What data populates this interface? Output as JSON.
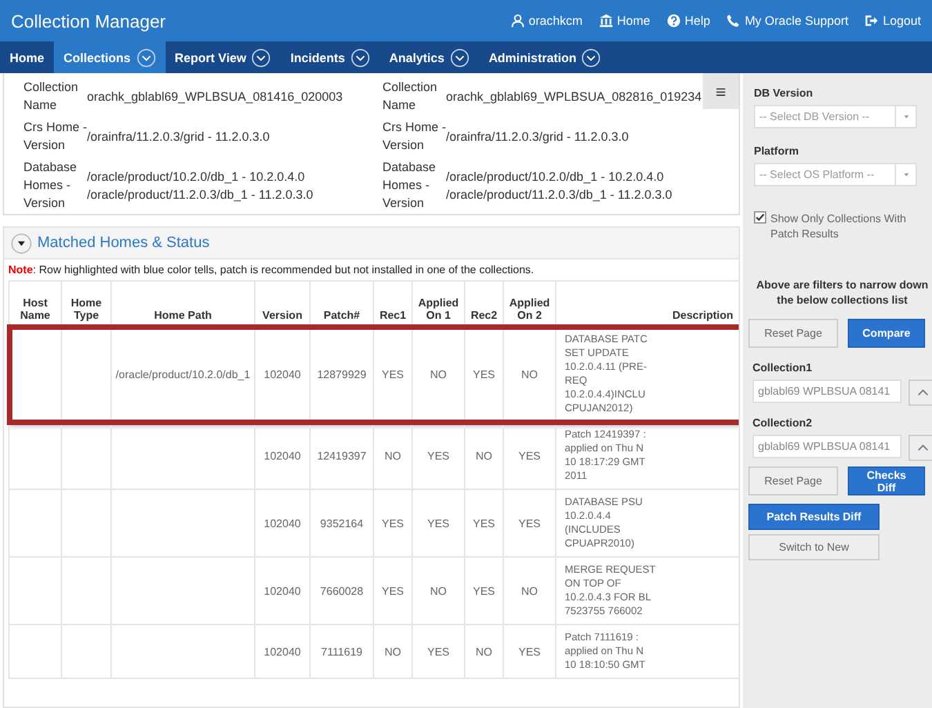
{
  "header": {
    "title": "Collection Manager",
    "links": [
      {
        "kind": "user",
        "label": "orachkcm"
      },
      {
        "kind": "home",
        "label": "Home"
      },
      {
        "kind": "help",
        "label": "Help"
      },
      {
        "kind": "phone",
        "label": "My Oracle Support"
      },
      {
        "kind": "logout",
        "label": "Logout"
      }
    ]
  },
  "nav": {
    "tabs": [
      {
        "label": "Home",
        "selected": false,
        "has_menu": false
      },
      {
        "label": "Collections",
        "selected": true,
        "has_menu": true
      },
      {
        "label": "Report View",
        "selected": false,
        "has_menu": true
      },
      {
        "label": "Incidents",
        "selected": false,
        "has_menu": true
      },
      {
        "label": "Analytics",
        "selected": false,
        "has_menu": true
      },
      {
        "label": "Administration",
        "selected": false,
        "has_menu": true
      }
    ]
  },
  "info": {
    "columns": [
      {
        "rows": [
          {
            "label": "Collection Name",
            "values": [
              "orachk_gblabl69_WPLBSUA_081416_020003"
            ]
          },
          {
            "label": "Crs Home - Version",
            "values": [
              "/orainfra/11.2.0.3/grid - 11.2.0.3.0"
            ]
          },
          {
            "label": "Database Homes - Version",
            "values": [
              "/oracle/product/10.2.0/db_1 - 10.2.0.4.0",
              "/oracle/product/11.2.0.3/db_1 - 11.2.0.3.0"
            ]
          }
        ]
      },
      {
        "rows": [
          {
            "label": "Collection Name",
            "values": [
              "orachk_gblabl69_WPLBSUA_082816_019234"
            ]
          },
          {
            "label": "Crs Home - Version",
            "values": [
              "/orainfra/11.2.0.3/grid - 11.2.0.3.0"
            ]
          },
          {
            "label": "Database Homes - Version",
            "values": [
              "/oracle/product/10.2.0/db_1 - 10.2.0.4.0",
              "/oracle/product/11.2.0.3/db_1 - 11.2.0.3.0"
            ]
          }
        ]
      }
    ],
    "menu_button": "≡"
  },
  "matched": {
    "title": "Matched Homes & Status",
    "expanded": true,
    "note_label": "Note",
    "note_text": ": Row highlighted with blue color tells, patch is recommended but not installed in one of the collections.",
    "columns": [
      "Host Name",
      "Home Type",
      "Home Path",
      "Version",
      "Patch#",
      "Rec1",
      "Applied On 1",
      "Rec2",
      "Applied On 2",
      "Description"
    ],
    "rows": [
      {
        "highlighted": true,
        "home_path": "/oracle/product/10.2.0/db_1",
        "version": "102040",
        "patch": "12879929",
        "rec1": "YES",
        "applied1": "NO",
        "rec2": "YES",
        "applied2": "NO",
        "description_lines": [
          "DATABASE PATC",
          "SET UPDATE",
          "10.2.0.4.11 (PRE-",
          "REQ",
          "10.2.0.4.4)INCLU",
          "CPUJAN2012)"
        ]
      },
      {
        "highlighted": false,
        "version": "102040",
        "patch": "12419397",
        "rec1": "NO",
        "applied1": "YES",
        "rec2": "NO",
        "applied2": "YES",
        "description_lines": [
          "Patch 12419397 :",
          "applied on Thu N",
          "10 18:17:29 GMT",
          "2011"
        ]
      },
      {
        "highlighted": false,
        "version": "102040",
        "patch": "9352164",
        "rec1": "YES",
        "applied1": "YES",
        "rec2": "YES",
        "applied2": "YES",
        "description_lines": [
          "DATABASE PSU",
          "10.2.0.4.4",
          "(INCLUDES",
          "CPUAPR2010)"
        ]
      },
      {
        "highlighted": false,
        "version": "102040",
        "patch": "7660028",
        "rec1": "YES",
        "applied1": "NO",
        "rec2": "YES",
        "applied2": "NO",
        "description_lines": [
          "MERGE REQUEST",
          "ON TOP OF",
          "10.2.0.4.3 FOR BL",
          "7523755 766002"
        ]
      },
      {
        "highlighted": false,
        "version": "102040",
        "patch": "7111619",
        "rec1": "NO",
        "applied1": "YES",
        "rec2": "NO",
        "applied2": "YES",
        "description_lines": [
          "Patch 7111619 :",
          "applied on Thu N",
          "10 18:10:50 GMT"
        ]
      }
    ]
  },
  "sidebar": {
    "selects": [
      {
        "label": "DB Version",
        "placeholder": "-- Select DB Version --"
      },
      {
        "label": "Platform",
        "placeholder": "-- Select OS Platform --"
      }
    ],
    "checkbox": {
      "label": "Show Only Collections With Patch Results",
      "checked": true
    },
    "filter_note": "Above are filters to narrow down the below collections list",
    "buttons1": [
      {
        "kind": "secondary",
        "label": "Reset Page"
      },
      {
        "kind": "primary",
        "label": "Compare"
      }
    ],
    "collections": [
      {
        "label": "Collection1",
        "value": "gblabl69 WPLBSUA 08141"
      },
      {
        "label": "Collection2",
        "value": "gblabl69 WPLBSUA 08141"
      }
    ],
    "buttons2": [
      {
        "kind": "secondary",
        "label": "Reset Page"
      },
      {
        "kind": "primary",
        "label": "Checks Diff"
      }
    ],
    "buttons3": [
      {
        "kind": "primary",
        "label": "Patch Results Diff"
      },
      {
        "kind": "secondary",
        "label": "Switch to New"
      }
    ]
  }
}
